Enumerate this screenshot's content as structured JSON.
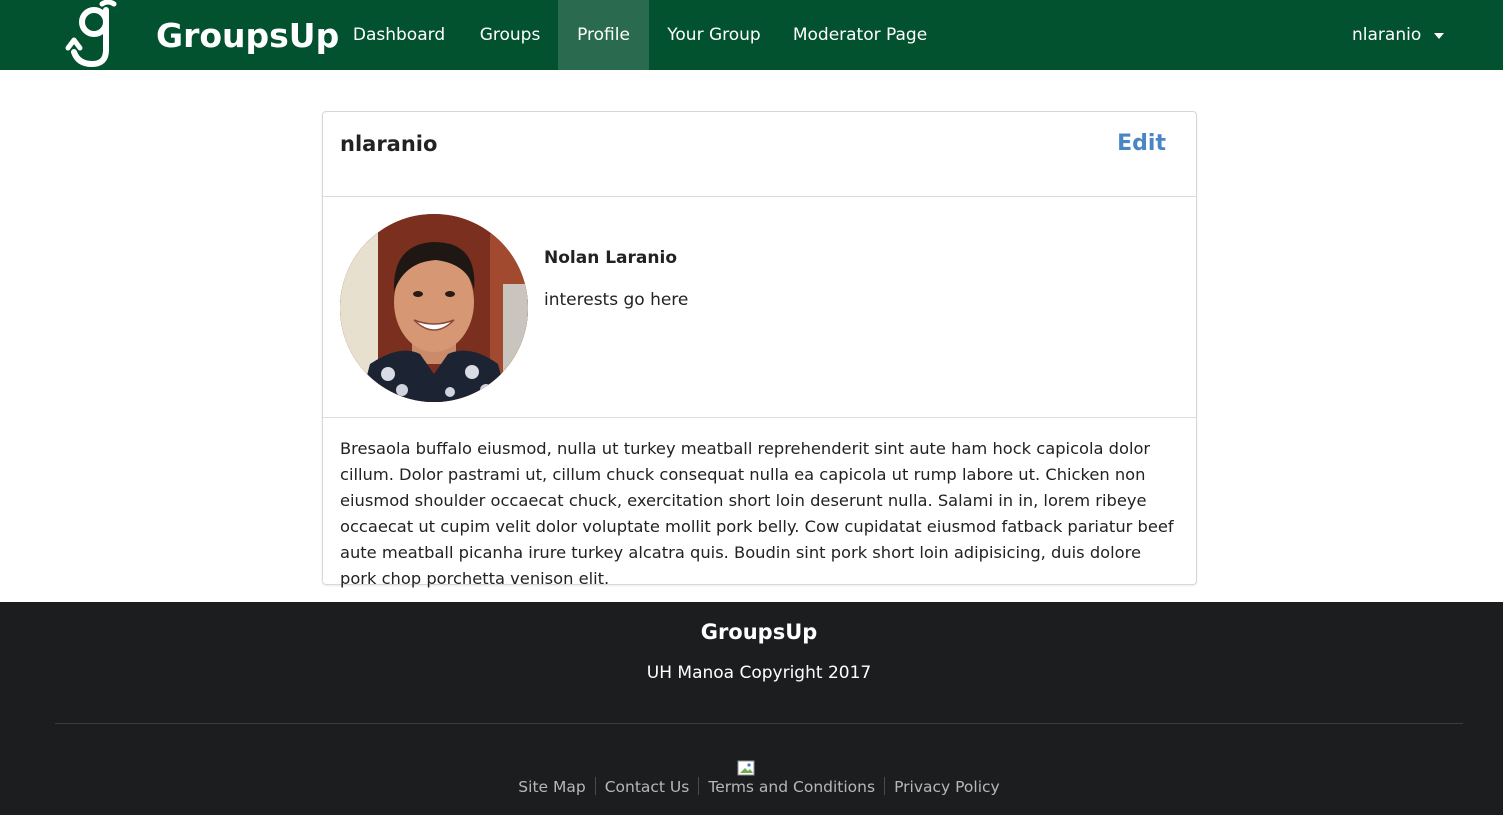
{
  "navbar": {
    "brand": "GroupsUp",
    "items": [
      {
        "label": "Dashboard",
        "active": false
      },
      {
        "label": "Groups",
        "active": false
      },
      {
        "label": "Profile",
        "active": true
      },
      {
        "label": "Your Group",
        "active": false
      },
      {
        "label": "Moderator Page",
        "active": false
      }
    ],
    "user_menu_label": "nlaranio",
    "background_color": "#02512f",
    "active_color": "#2a6b4f"
  },
  "profile": {
    "username": "nlaranio",
    "edit_label": "Edit",
    "full_name": "Nolan Laranio",
    "interests": "interests go here",
    "bio": "Bresaola buffalo eiusmod, nulla ut turkey meatball reprehenderit sint aute ham hock capicola dolor cillum. Dolor pastrami ut, cillum chuck consequat nulla ea capicola ut rump labore ut. Chicken non eiusmod shoulder occaecat chuck, exercitation short loin deserunt nulla. Salami in in, lorem ribeye occaecat ut cupim velit dolor voluptate mollit pork belly. Cow cupidatat eiusmod fatback pariatur beef aute meatball picanha irure turkey alcatra quis. Boudin sint pork short loin adipisicing, duis dolore pork chop porchetta venison elit.",
    "edit_color": "#4a86c5"
  },
  "footer": {
    "title": "GroupsUp",
    "copyright": "UH Manoa Copyright 2017",
    "links": [
      "Site Map",
      "Contact Us",
      "Terms and Conditions",
      "Privacy Policy"
    ],
    "background_color": "#1c1d1f"
  }
}
